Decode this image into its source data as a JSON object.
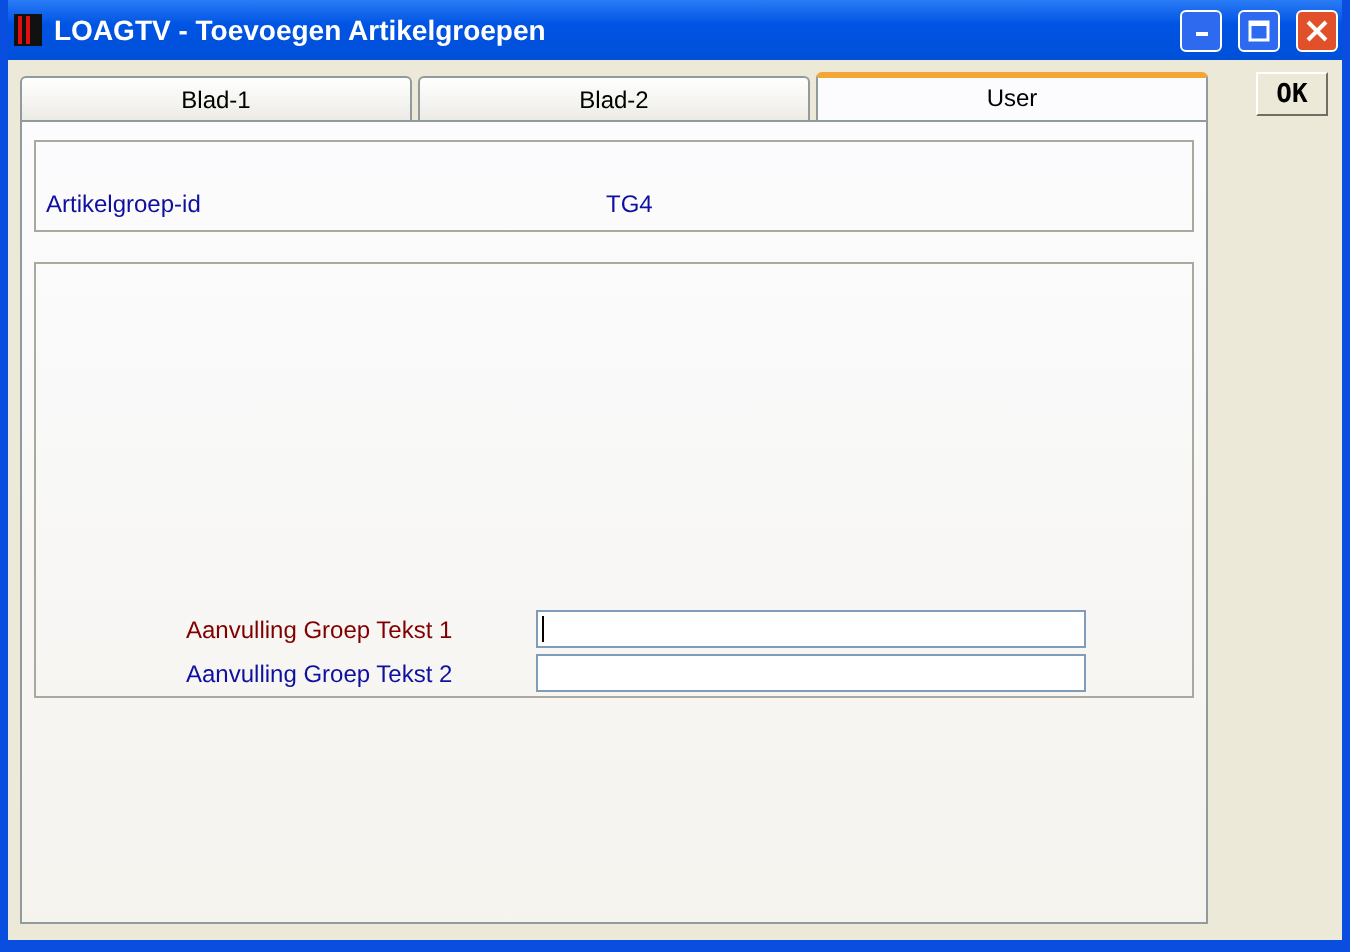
{
  "window": {
    "title": "LOAGTV - Toevoegen Artikelgroepen"
  },
  "tabs": [
    {
      "label": "Blad-1",
      "selected": false
    },
    {
      "label": "Blad-2",
      "selected": false
    },
    {
      "label": "User",
      "selected": true
    }
  ],
  "ok_button": {
    "label": "OK"
  },
  "id_field": {
    "label": "Artikelgroep-id",
    "value": "TG4"
  },
  "fields": [
    {
      "label": "Aanvulling Groep Tekst 1",
      "focused": true
    },
    {
      "label": "Aanvulling Groep Tekst 2",
      "focused": false
    }
  ]
}
